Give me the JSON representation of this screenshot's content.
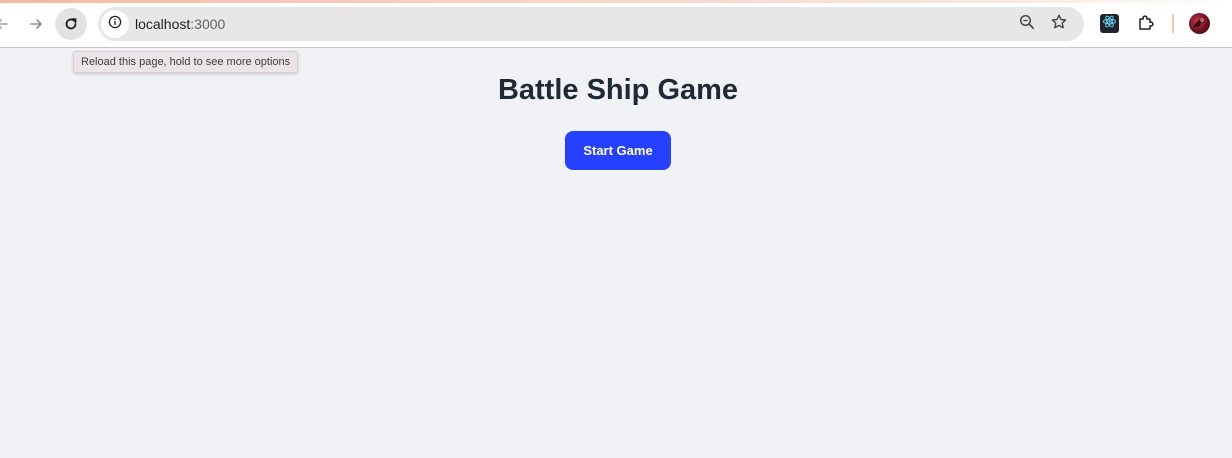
{
  "browser": {
    "url_host": "localhost",
    "url_port": ":3000",
    "tooltip": "Reload this page, hold to see more options"
  },
  "icons": {
    "back": "arrow-left-icon",
    "forward": "arrow-right-icon",
    "reload": "reload-icon",
    "site_info": "info-icon",
    "zoom": "zoom-icon",
    "bookmark": "star-icon",
    "react_devtools": "react-icon",
    "extensions": "puzzle-icon",
    "profile": "avatar"
  },
  "page": {
    "title": "Battle Ship Game",
    "start_button": "Start Game"
  },
  "colors": {
    "page_background": "#f1f2f6",
    "title": "#1f2937",
    "button": "#2540ff",
    "button_text": "#ffffff"
  }
}
